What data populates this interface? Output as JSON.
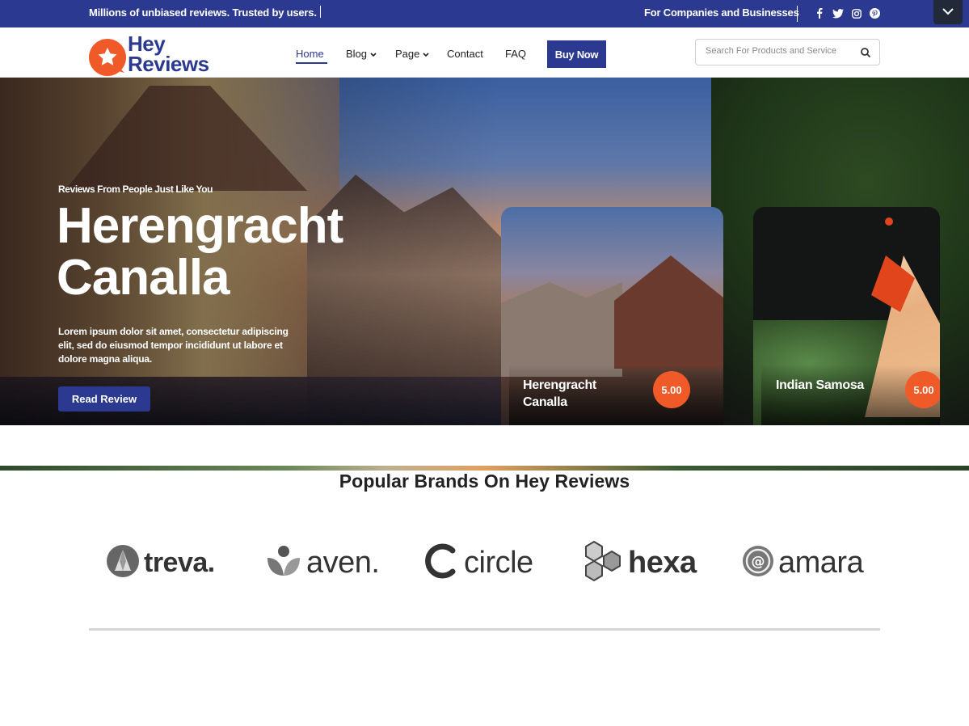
{
  "topbar": {
    "tagline": "Millions of unbiased reviews. Trusted by users.",
    "companies_link": "For Companies and Businesses",
    "socials": [
      "facebook-icon",
      "twitter-icon",
      "instagram-icon",
      "pinterest-icon"
    ],
    "bg_color": "#2b3990"
  },
  "header": {
    "logo_line1": "Hey",
    "logo_line2": "Reviews",
    "nav": {
      "home": "Home",
      "blog": "Blog",
      "page": "Page",
      "contact": "Contact",
      "faq": "FAQ"
    },
    "buy_now": "Buy Now",
    "search_placeholder": "Search For Products and Service"
  },
  "hero": {
    "subtitle": "Reviews From People Just Like You",
    "title": "Herengracht Canalla",
    "description": "Lorem ipsum dolor sit amet, consectetur adipiscing elit, sed do eiusmod tempor incididunt ut labore et dolore magna aliqua.",
    "button": "Read Review",
    "cards": [
      {
        "name": "Herengracht Canalla",
        "rating": "5.00"
      },
      {
        "name": "Indian Samosa",
        "rating": "5.00"
      }
    ]
  },
  "brands": {
    "title": "Popular Brands On Hey Reviews",
    "items": [
      {
        "name": "treva.",
        "icon": "treva-logo-icon"
      },
      {
        "name": "aven.",
        "icon": "aven-logo-icon"
      },
      {
        "name": "circle",
        "icon": "circle-logo-icon"
      },
      {
        "name": "hexa",
        "icon": "hexa-logo-icon"
      },
      {
        "name": "amara",
        "icon": "amara-logo-icon"
      }
    ]
  },
  "colors": {
    "primary": "#2b3990",
    "accent": "#f05a28"
  }
}
